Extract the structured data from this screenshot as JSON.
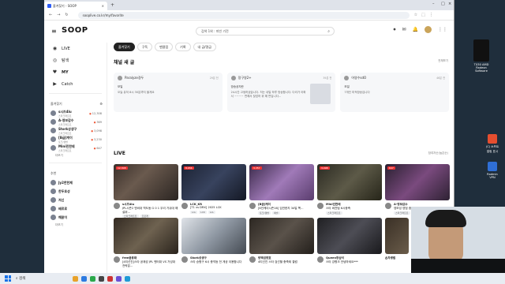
{
  "browser": {
    "tab_title": "즐겨찾기 - SOOP",
    "url": "sooplive.co.kr/my/favorite"
  },
  "site": {
    "logo": "SOOP",
    "search_placeholder": "검색 1위 : 피빈 기전"
  },
  "sidebar": {
    "nav": [
      {
        "icon": "live-icon",
        "label": "LIVE"
      },
      {
        "icon": "compass-icon",
        "label": "탐색"
      },
      {
        "icon": "heart-icon",
        "label": "MY"
      },
      {
        "icon": "catch-icon",
        "label": "Catch"
      }
    ],
    "favorites_title": "즐겨찾기",
    "favorites": [
      {
        "name": "s시즈4lu",
        "sub": "스타크래프트",
        "count": "12,308"
      },
      {
        "name": "A-영보감수",
        "sub": "스타크래프트",
        "count": "369"
      },
      {
        "name": "Stork성생구",
        "sub": "스타크래프트",
        "count": "3,098"
      },
      {
        "name": "[B급]케이",
        "sub": "토크/캠방",
        "count": "3,230"
      },
      {
        "name": "Mini민한테",
        "sub": "스타크래프트",
        "count": "647"
      }
    ],
    "favorites_more": "더보기",
    "recommend_title": "추천",
    "recommends": [
      {
        "name": "Jy2한한제"
      },
      {
        "name": "한두호성"
      },
      {
        "name": "저신"
      },
      {
        "name": "배르로"
      },
      {
        "name": "해맑이"
      }
    ],
    "recommend_more": "더보기"
  },
  "main": {
    "tabs": [
      "즐겨찾기",
      "구독",
      "팬클럽",
      "기록",
      "내 급/명급"
    ],
    "posts_title": "채널 새 글",
    "posts_more": "전체보기",
    "posts": [
      {
        "author": "Paralyze경두",
        "date": "29분 전",
        "label": "모일",
        "text": "오늘 유저 8시 30분까지 올게요"
      },
      {
        "author": "정구영2+",
        "date": "39분 전",
        "label": "방송공지란",
        "text": "24시간 고생하셨습니다. 저는 내일 하루 방송합니다. 다리가 아파서 ~~~~ 편해서 찾았하 위 해 편입니다..."
      },
      {
        "author": "어영수sdO",
        "date": "46분 전",
        "label": "모일",
        "text": "7개인 미적방송입니다"
      }
    ],
    "live_title": "LIVE",
    "live_sort": "참여자순(높은순)",
    "live_row1": [
      {
        "viewers": "12,308",
        "name": "s시즈4lu",
        "title": "JPL시즌2 엔비대 역도동 G 0 1 우리 거쉬대 해설위...",
        "tags": [
          "스타크래프트",
          "프로게"
        ]
      },
      {
        "viewers": "8,656",
        "name": "LCK_KR",
        "title": "[T1 vs DRX] 2025 LCK",
        "tags": [
          "LoL",
          "LCK",
          "LoL"
        ]
      },
      {
        "viewers": "3,357",
        "name": "[B급]케이",
        "title": "[6인케이시즌16] 임연한지 34일 쪽...",
        "tags": [
          "토크/캠방",
          "애슬"
        ]
      },
      {
        "viewers": "3,098",
        "name": "Mini민한테",
        "title": "스타 버전팀 6시종즉",
        "tags": [
          "스타크래프트"
        ]
      },
      {
        "viewers": "647",
        "name": "A-영보감수",
        "title": "영보성 영범 중표한냉쓰(...FVB)",
        "tags": [
          "스타크래프트",
          "매"
        ]
      }
    ],
    "live_row2": [
      {
        "name": "free윤용태",
        "title": "[4티선진]스타 공제성 JPL 멘터대 VS 거성대 전략분..."
      },
      {
        "name": "Stork성생구",
        "title": "스타 승병구 6시 충직등 전 게공 이용합니다"
      },
      {
        "name": "방액검영호",
        "title": "4티선진 스타 검선할 충죽제 결럼"
      },
      {
        "name": "Queen장삼석",
        "title": "스타 강병크 안녕하세요***"
      },
      {
        "name": "손자병법",
        "title": "..."
      }
    ]
  },
  "desktop": {
    "icons": [
      {
        "label": "TX30 AMD Radeon Software",
        "color": "#1a1a1a"
      },
      {
        "label": "(C) 소프트"
      },
      {
        "label": "알림 표시"
      },
      {
        "label": "Radmin VPN"
      }
    ]
  },
  "taskbar": {
    "search": "검색"
  }
}
